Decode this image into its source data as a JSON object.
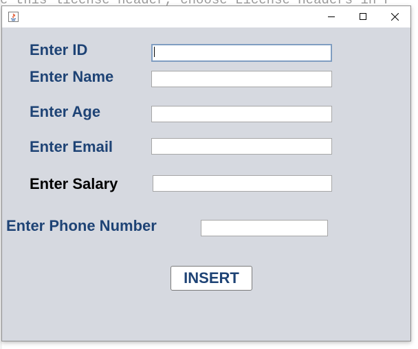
{
  "background": {
    "code_text": "e this license header, choose License Headers in P"
  },
  "window": {
    "title": "",
    "controls": {
      "minimize": "minimize-icon",
      "maximize": "maximize-icon",
      "close": "close-icon"
    }
  },
  "form": {
    "fields": [
      {
        "label": "Enter ID",
        "value": ""
      },
      {
        "label": "Enter Name",
        "value": ""
      },
      {
        "label": "Enter Age",
        "value": ""
      },
      {
        "label": "Enter Email",
        "value": ""
      },
      {
        "label": "Enter Salary",
        "value": ""
      },
      {
        "label": "Enter Phone Number",
        "value": ""
      }
    ],
    "submit_label": "INSERT"
  },
  "colors": {
    "label": "#1e4375",
    "salary_label": "#000000",
    "panel_background": "#d6d9e0"
  }
}
